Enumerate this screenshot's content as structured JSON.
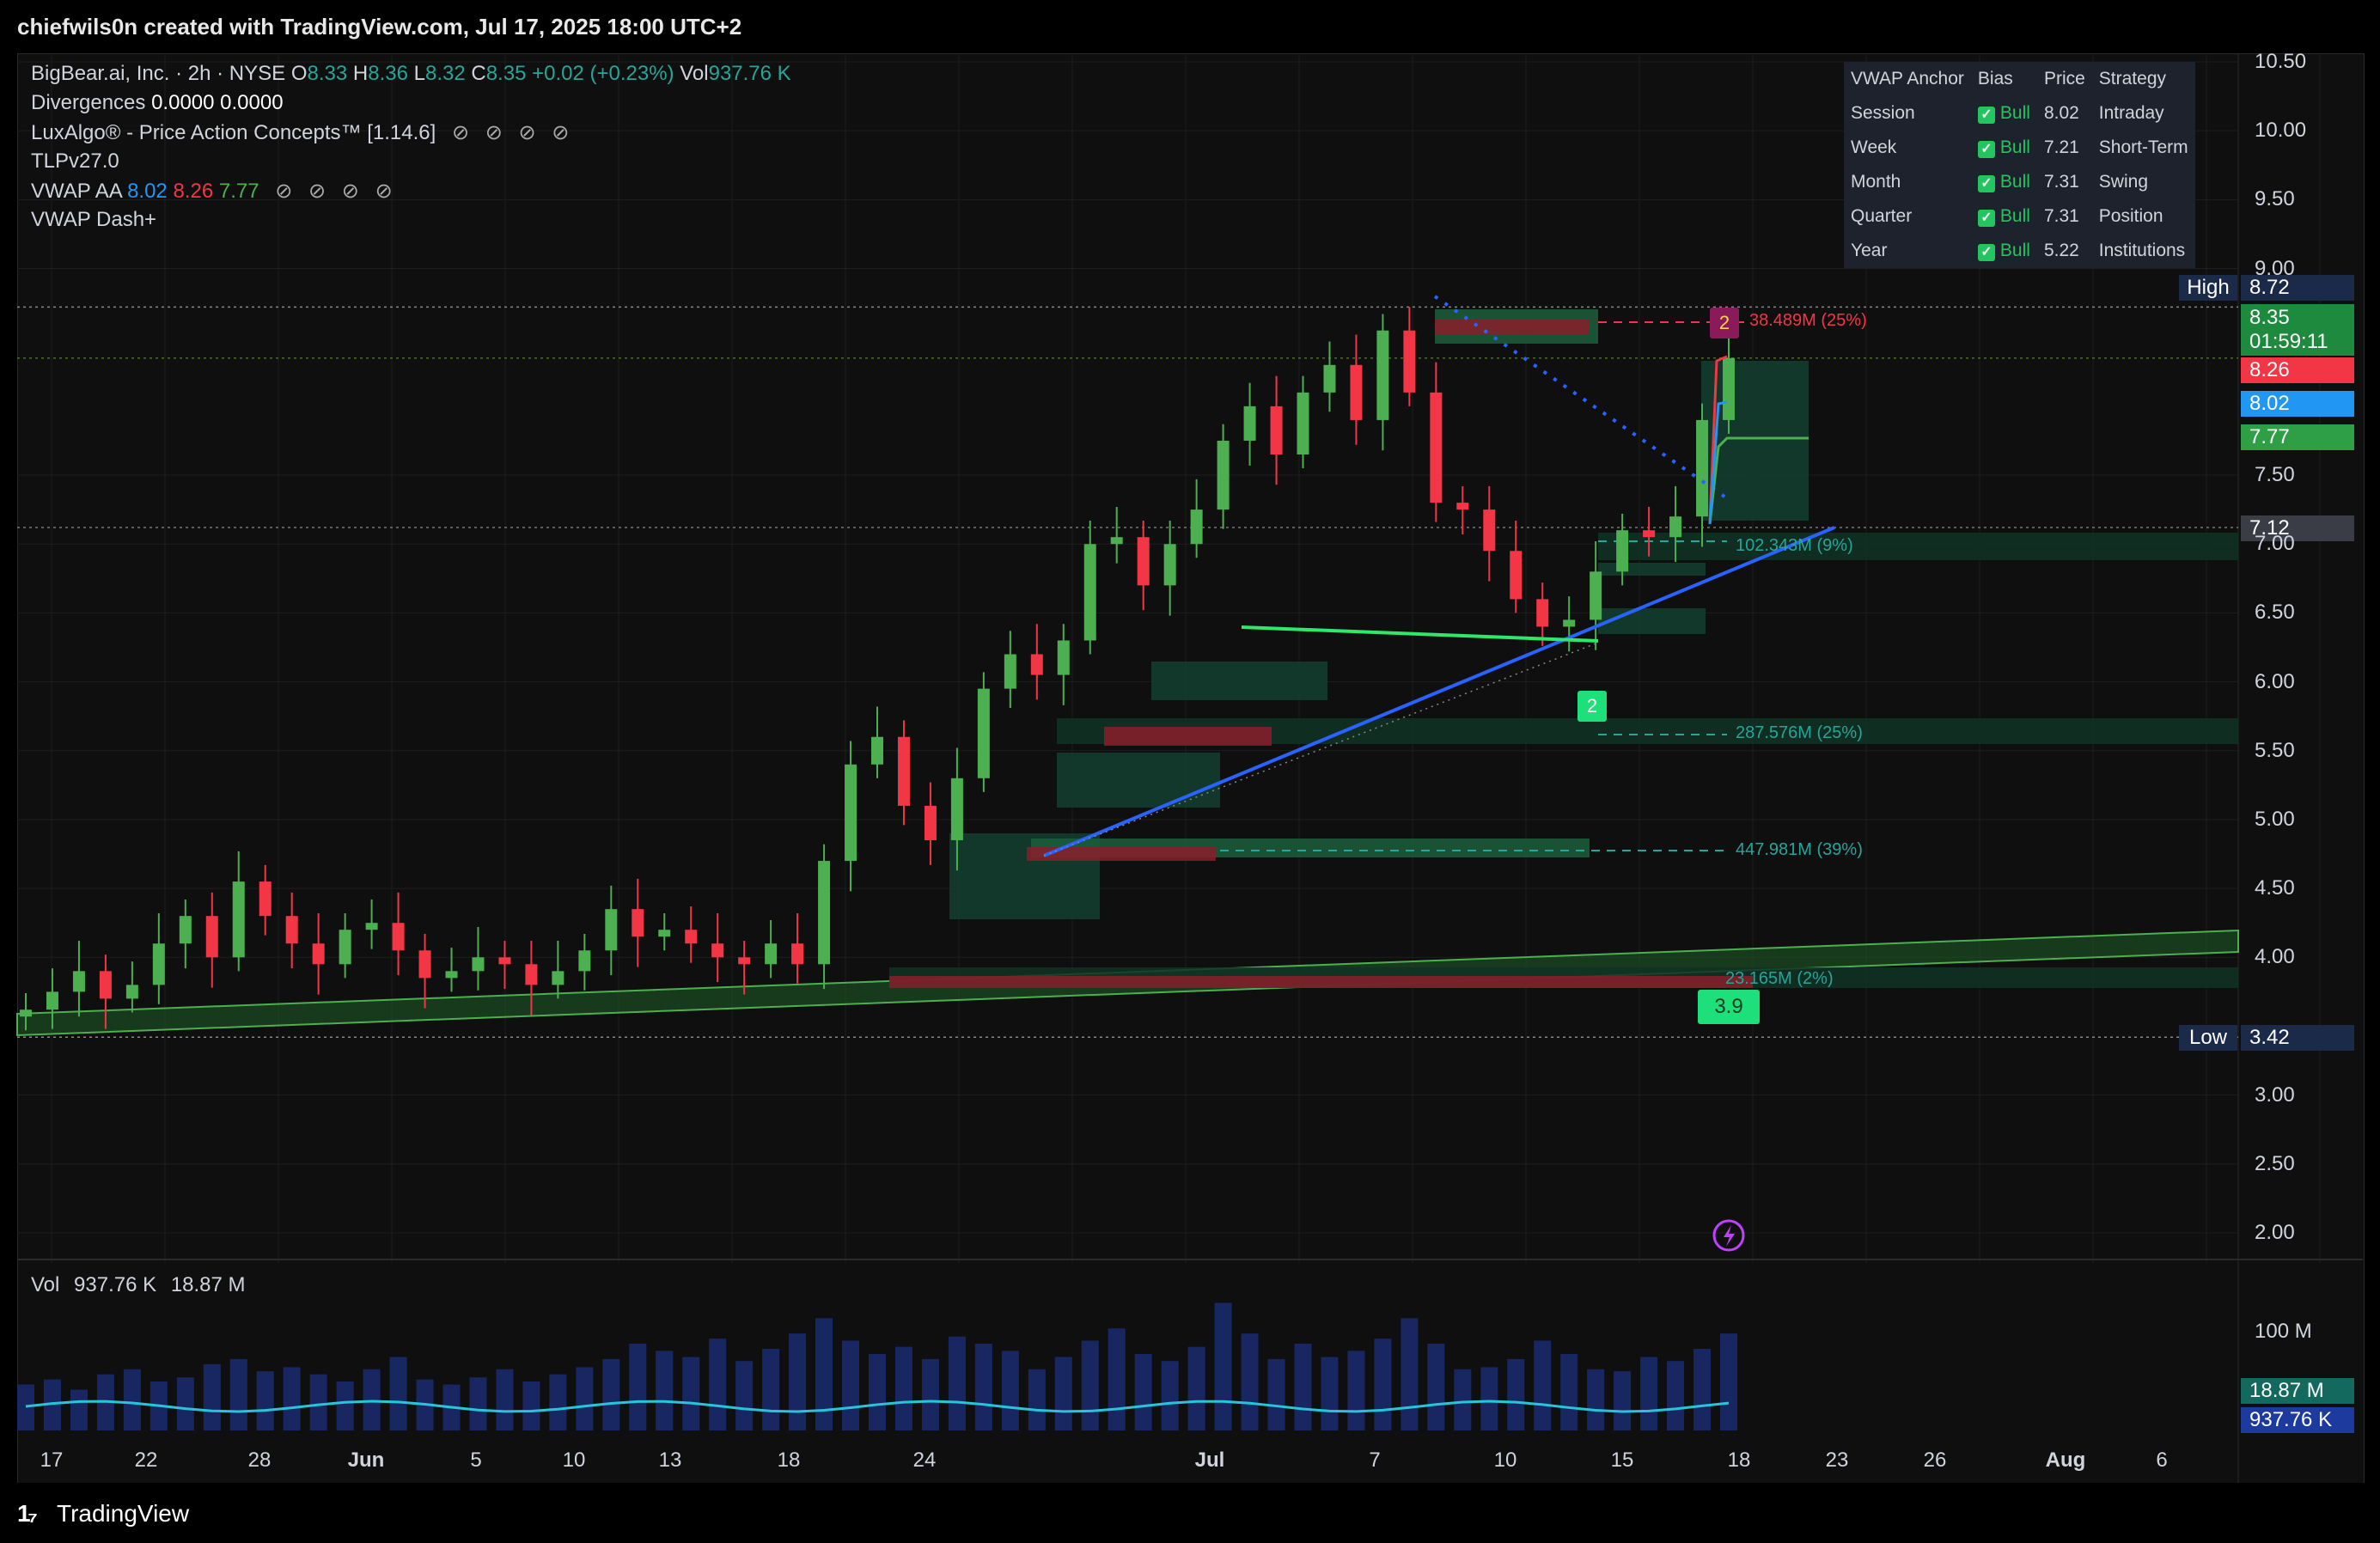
{
  "header": {
    "caption": "chiefwils0n created with TradingView.com, Jul 17, 2025 18:00 UTC+2"
  },
  "legend": {
    "symbol": "BigBear.ai, Inc. · 2h · NYSE",
    "o_label": "O",
    "o": "8.33",
    "h_label": "H",
    "h": "8.36",
    "l_label": "L",
    "l": "8.32",
    "c_label": "C",
    "c": "8.35",
    "change": "+0.02 (+0.23%)",
    "vol_label": "Vol",
    "vol": "937.76 K",
    "divergences_label": "Divergences",
    "div1": "0.0000",
    "div2": "0.0000",
    "luxalgo": "LuxAlgo® - Price Action Concepts™ [1.14.6]",
    "tlp": "TLPv27.0",
    "vwap_label": "VWAP AA",
    "vwap1": "8.02",
    "vwap2": "8.26",
    "vwap3": "7.77",
    "dash": "VWAP Dash+",
    "eyes": "⊘ ⊘ ⊘ ⊘"
  },
  "vwap_table": {
    "headers": [
      "VWAP Anchor",
      "Bias",
      "Price",
      "Strategy"
    ],
    "rows": [
      {
        "anchor": "Session",
        "bias": "Bull",
        "price": "8.02",
        "strategy": "Intraday"
      },
      {
        "anchor": "Week",
        "bias": "Bull",
        "price": "7.21",
        "strategy": "Short-Term"
      },
      {
        "anchor": "Month",
        "bias": "Bull",
        "price": "7.31",
        "strategy": "Swing"
      },
      {
        "anchor": "Quarter",
        "bias": "Bull",
        "price": "7.31",
        "strategy": "Position"
      },
      {
        "anchor": "Year",
        "bias": "Bull",
        "price": "5.22",
        "strategy": "Institutions"
      }
    ]
  },
  "price_labels": {
    "high_tag": "High",
    "high": "8.72",
    "last": "8.35",
    "countdown": "01:59:11",
    "red": "8.26",
    "blue": "8.02",
    "green": "7.77",
    "gray": "7.12",
    "low_tag": "Low",
    "low": "3.42"
  },
  "annotations": {
    "ob1": "38.489M (25%)",
    "ob2": "102.343M (9%)",
    "ob3": "287.576M (25%)",
    "ob4": "447.981M (39%)",
    "ob5": "23.165M (2%)",
    "marker_top": "2",
    "marker_mid": "2",
    "marker_low": "3.9"
  },
  "volume_legend": {
    "label": "Vol",
    "v1": "937.76 K",
    "v2": "18.87 M"
  },
  "volume_labels": {
    "scale": "100 M",
    "ma": "18.87 M",
    "last": "937.76 K"
  },
  "colors": {
    "up": "#26a69a",
    "up_bar": "#4caf50",
    "down": "#f23645",
    "vwap_blue": "#2196f3",
    "zone_green": "#1b5e3c",
    "bg": "#0f0f0f",
    "vol_bar": "#1a2a6c",
    "vol_ma": "#26c6da"
  },
  "brand": "TradingView",
  "chart_data": {
    "type": "candlestick",
    "title": "BigBear.ai, Inc. · 2h · NYSE",
    "y_ticks": [
      "10.50",
      "10.00",
      "9.50",
      "9.00",
      "7.50",
      "7.00",
      "6.50",
      "6.00",
      "5.50",
      "5.00",
      "4.50",
      "4.00",
      "3.00",
      "2.50",
      "2.00"
    ],
    "ylim": [
      1.9,
      10.6
    ],
    "x_ticks": [
      {
        "label": "17",
        "bold": false
      },
      {
        "label": "22",
        "bold": false
      },
      {
        "label": "28",
        "bold": false
      },
      {
        "label": "Jun",
        "bold": true
      },
      {
        "label": "5",
        "bold": false
      },
      {
        "label": "10",
        "bold": false
      },
      {
        "label": "13",
        "bold": false
      },
      {
        "label": "18",
        "bold": false
      },
      {
        "label": "24",
        "bold": false
      },
      {
        "label": "Jul",
        "bold": true
      },
      {
        "label": "7",
        "bold": false
      },
      {
        "label": "10",
        "bold": false
      },
      {
        "label": "15",
        "bold": false
      },
      {
        "label": "18",
        "bold": false
      },
      {
        "label": "23",
        "bold": false
      },
      {
        "label": "26",
        "bold": false
      },
      {
        "label": "Aug",
        "bold": true
      },
      {
        "label": "6",
        "bold": false
      }
    ],
    "close_path": [
      3.62,
      3.75,
      3.9,
      3.7,
      3.8,
      4.1,
      4.3,
      4.0,
      4.55,
      4.3,
      4.1,
      3.95,
      4.2,
      4.25,
      4.05,
      3.85,
      3.9,
      4.0,
      3.95,
      3.8,
      3.9,
      4.05,
      4.35,
      4.15,
      4.2,
      4.1,
      4.0,
      3.95,
      4.1,
      3.95,
      4.7,
      5.4,
      5.6,
      5.1,
      4.85,
      5.3,
      5.95,
      6.2,
      6.05,
      6.3,
      7.0,
      7.05,
      6.7,
      7.0,
      7.25,
      7.75,
      8.0,
      7.65,
      8.1,
      8.3,
      7.9,
      8.55,
      8.1,
      7.3,
      7.25,
      6.95,
      6.6,
      6.4,
      6.45,
      6.8,
      7.1,
      7.05,
      7.2,
      7.9,
      8.35
    ],
    "volume_m": [
      45,
      50,
      40,
      55,
      60,
      48,
      52,
      65,
      70,
      58,
      62,
      55,
      48,
      60,
      72,
      50,
      45,
      52,
      60,
      48,
      55,
      62,
      70,
      85,
      78,
      72,
      90,
      68,
      80,
      95,
      110,
      88,
      75,
      82,
      70,
      92,
      85,
      78,
      60,
      72,
      88,
      100,
      75,
      68,
      82,
      125,
      95,
      70,
      85,
      72,
      78,
      90,
      110,
      85,
      60,
      62,
      70,
      88,
      75,
      60,
      58,
      72,
      68,
      80,
      95
    ],
    "volume_ylim": [
      0,
      160
    ],
    "order_blocks": [
      {
        "label": "38.489M (25%)",
        "price": 8.45
      },
      {
        "label": "102.343M (9%)",
        "price": 7.0
      },
      {
        "label": "287.576M (25%)",
        "price": 5.65
      },
      {
        "label": "447.981M (39%)",
        "price": 4.8
      },
      {
        "label": "23.165M (2%)",
        "price": 3.85
      }
    ]
  }
}
